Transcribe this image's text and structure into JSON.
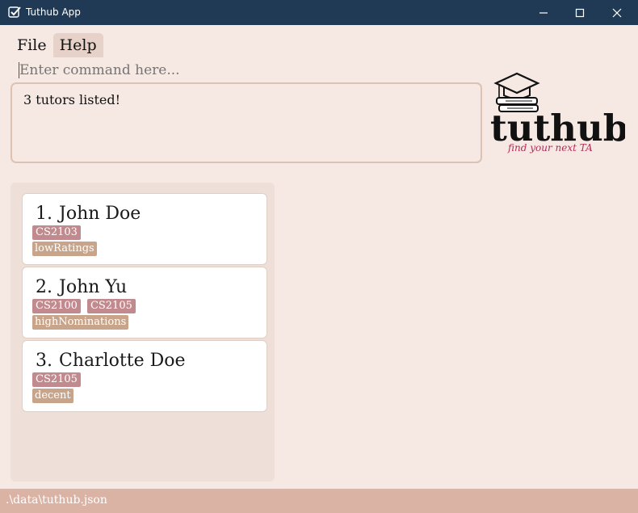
{
  "window": {
    "title": "Tuthub App"
  },
  "menu": {
    "items": [
      "File",
      "Help"
    ]
  },
  "command": {
    "placeholder": "Enter command here...",
    "value": ""
  },
  "result": {
    "text": "3 tutors listed!"
  },
  "logo": {
    "text": "tuthub.",
    "tagline": "find your next TA"
  },
  "tutors": [
    {
      "index": "1.",
      "name": "John Doe",
      "modules": [
        "CS2103"
      ],
      "tags": [
        "lowRatings"
      ]
    },
    {
      "index": "2.",
      "name": "John Yu",
      "modules": [
        "CS2100",
        "CS2105"
      ],
      "tags": [
        "highNominations"
      ]
    },
    {
      "index": "3.",
      "name": "Charlotte Doe",
      "modules": [
        "CS2105"
      ],
      "tags": [
        "decent"
      ]
    }
  ],
  "status": {
    "path": ".\\data\\tuthub.json"
  },
  "colors": {
    "titlebar": "#203a56",
    "background": "#f6e8e2",
    "module_tag": "#c18a8e",
    "rating_tag": "#c8a58a",
    "statusbar": "#dbb3a5"
  }
}
